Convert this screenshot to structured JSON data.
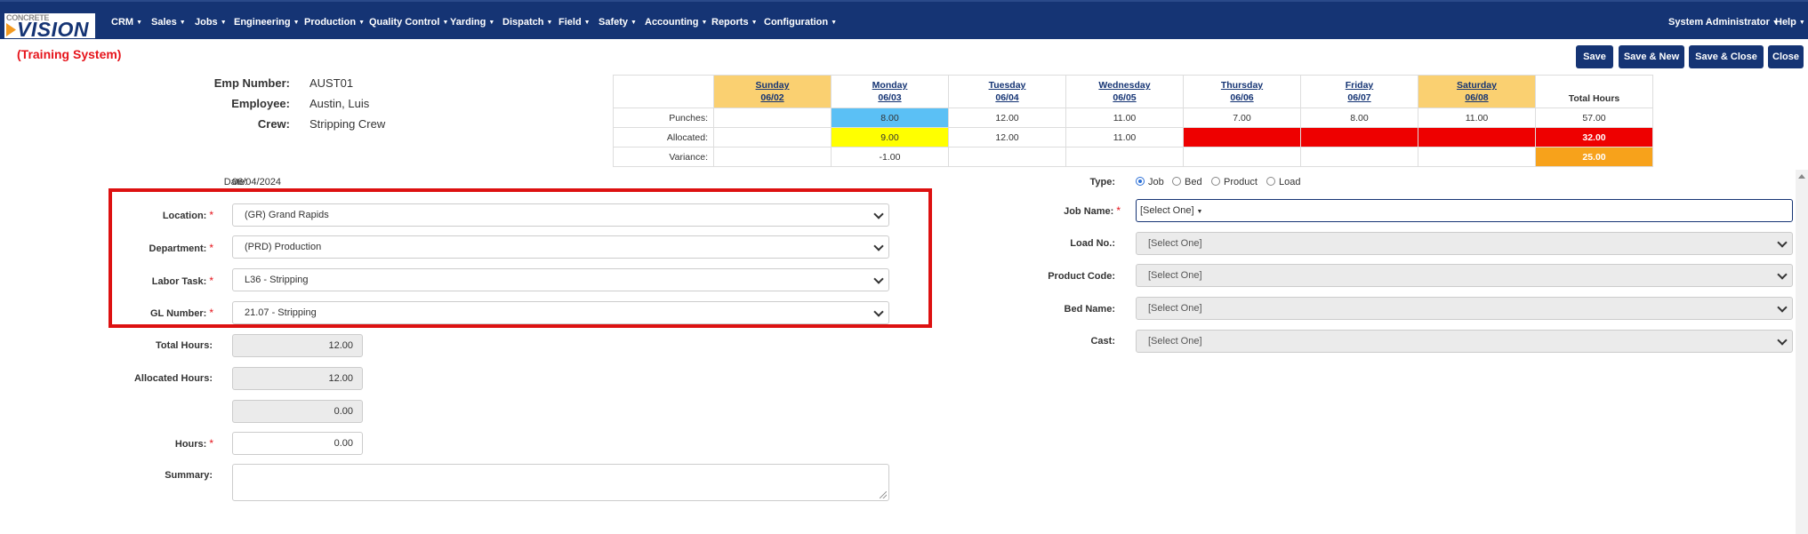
{
  "nav": {
    "logo_small": "CONCRETE",
    "logo_big": "VISION",
    "items": [
      "CRM",
      "Sales",
      "Jobs",
      "Engineering",
      "Production",
      "Quality Control",
      "Yarding",
      "Dispatch",
      "Field",
      "Safety",
      "Accounting",
      "Reports",
      "Configuration"
    ],
    "user": "System Administrator",
    "help": "Help"
  },
  "training_label": "(Training System)",
  "buttons": {
    "save": "Save",
    "save_new": "Save & New",
    "save_close": "Save & Close",
    "close": "Close"
  },
  "employee": {
    "emp_number_label": "Emp Number:",
    "emp_number": "AUST01",
    "employee_label": "Employee:",
    "employee": "Austin, Luis",
    "crew_label": "Crew:",
    "crew": "Stripping Crew"
  },
  "week": {
    "days": [
      {
        "name": "Sunday",
        "date": "06/02",
        "weekend": true
      },
      {
        "name": "Monday",
        "date": "06/03",
        "weekend": false
      },
      {
        "name": "Tuesday",
        "date": "06/04",
        "weekend": false
      },
      {
        "name": "Wednesday",
        "date": "06/05",
        "weekend": false
      },
      {
        "name": "Thursday",
        "date": "06/06",
        "weekend": false
      },
      {
        "name": "Friday",
        "date": "06/07",
        "weekend": false
      },
      {
        "name": "Saturday",
        "date": "06/08",
        "weekend": true
      }
    ],
    "total_label": "Total Hours",
    "rows": [
      {
        "label": "Punches:",
        "values": [
          "",
          "8.00",
          "12.00",
          "11.00",
          "7.00",
          "8.00",
          "11.00"
        ],
        "total": "57.00"
      },
      {
        "label": "Allocated:",
        "values": [
          "",
          "9.00",
          "12.00",
          "11.00",
          "",
          "",
          ""
        ],
        "total": "32.00"
      },
      {
        "label": "Variance:",
        "values": [
          "",
          "-1.00",
          "",
          "",
          "",
          "",
          ""
        ],
        "total": "25.00"
      }
    ]
  },
  "form": {
    "date_label": "Date:",
    "date": "06/04/2024",
    "location_label": "Location:",
    "location": "(GR) Grand Rapids",
    "department_label": "Department:",
    "department": "(PRD) Production",
    "labor_task_label": "Labor Task:",
    "labor_task": "L36 - Stripping",
    "gl_number_label": "GL Number:",
    "gl_number": "21.07 - Stripping",
    "total_hours_label": "Total Hours:",
    "total_hours": "12.00",
    "allocated_hours_label": "Allocated Hours:",
    "allocated_hours": "12.00",
    "remaining_hours": "0.00",
    "hours_label": "Hours:",
    "hours": "0.00",
    "summary_label": "Summary:",
    "summary": ""
  },
  "right_form": {
    "type_label": "Type:",
    "type_options": [
      "Job",
      "Bed",
      "Product",
      "Load"
    ],
    "type_selected": "Job",
    "job_name_label": "Job Name:",
    "job_name": "[Select One]",
    "load_no_label": "Load No.:",
    "load_no": "[Select One]",
    "product_code_label": "Product Code:",
    "product_code": "[Select One]",
    "bed_name_label": "Bed Name:",
    "bed_name": "[Select One]",
    "cast_label": "Cast:",
    "cast": "[Select One]"
  },
  "colors": {
    "nav": "#153474",
    "weekend": "#fad071",
    "punch_highlight": "#5bc0f5",
    "allocated_highlight": "#ffff00",
    "error": "#ee0000",
    "variance_total": "#f7a21b"
  }
}
